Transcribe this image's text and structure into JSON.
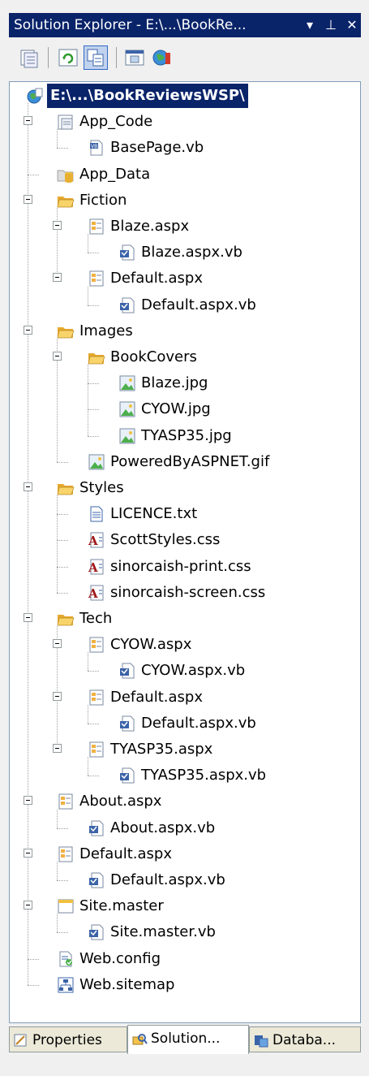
{
  "window": {
    "title": "Solution Explorer - E:\\...\\BookRe...",
    "buttons": [
      "▾",
      "⊥",
      "✕"
    ]
  },
  "toolbar": {
    "buttons": [
      "properties-icon",
      "refresh-icon",
      "nest-related-files-icon",
      "view-designer-icon",
      "copy-website-icon"
    ]
  },
  "tree": {
    "root": "E:\\...\\BookReviewsWSP\\",
    "nodes": [
      {
        "label": "App_Code",
        "icon": "special-folder-icon"
      },
      {
        "label": "BasePage.vb",
        "icon": "vb-file-icon"
      },
      {
        "label": "App_Data",
        "icon": "data-folder-icon"
      },
      {
        "label": "Fiction",
        "icon": "folder-open-icon"
      },
      {
        "label": "Blaze.aspx",
        "icon": "aspx-file-icon"
      },
      {
        "label": "Blaze.aspx.vb",
        "icon": "codebehind-icon"
      },
      {
        "label": "Default.aspx",
        "icon": "aspx-file-icon"
      },
      {
        "label": "Default.aspx.vb",
        "icon": "codebehind-icon"
      },
      {
        "label": "Images",
        "icon": "folder-open-icon"
      },
      {
        "label": "BookCovers",
        "icon": "folder-open-icon"
      },
      {
        "label": "Blaze.jpg",
        "icon": "image-file-icon"
      },
      {
        "label": "CYOW.jpg",
        "icon": "image-file-icon"
      },
      {
        "label": "TYASP35.jpg",
        "icon": "image-file-icon"
      },
      {
        "label": "PoweredByASPNET.gif",
        "icon": "image-file-icon"
      },
      {
        "label": "Styles",
        "icon": "folder-open-icon"
      },
      {
        "label": "LICENCE.txt",
        "icon": "text-file-icon"
      },
      {
        "label": "ScottStyles.css",
        "icon": "css-file-icon"
      },
      {
        "label": "sinorcaish-print.css",
        "icon": "css-file-icon"
      },
      {
        "label": "sinorcaish-screen.css",
        "icon": "css-file-icon"
      },
      {
        "label": "Tech",
        "icon": "folder-open-icon"
      },
      {
        "label": "CYOW.aspx",
        "icon": "aspx-file-icon"
      },
      {
        "label": "CYOW.aspx.vb",
        "icon": "codebehind-icon"
      },
      {
        "label": "Default.aspx",
        "icon": "aspx-file-icon"
      },
      {
        "label": "Default.aspx.vb",
        "icon": "codebehind-icon"
      },
      {
        "label": "TYASP35.aspx",
        "icon": "aspx-file-icon"
      },
      {
        "label": "TYASP35.aspx.vb",
        "icon": "codebehind-icon"
      },
      {
        "label": "About.aspx",
        "icon": "aspx-file-icon"
      },
      {
        "label": "About.aspx.vb",
        "icon": "codebehind-icon"
      },
      {
        "label": "Default.aspx",
        "icon": "aspx-file-icon"
      },
      {
        "label": "Default.aspx.vb",
        "icon": "codebehind-icon"
      },
      {
        "label": "Site.master",
        "icon": "master-file-icon"
      },
      {
        "label": "Site.master.vb",
        "icon": "codebehind-icon"
      },
      {
        "label": "Web.config",
        "icon": "config-file-icon"
      },
      {
        "label": "Web.sitemap",
        "icon": "sitemap-file-icon"
      }
    ]
  },
  "tabs": [
    {
      "label": "Properties",
      "icon": "properties-tab-icon",
      "active": false
    },
    {
      "label": "Solution...",
      "icon": "solution-explorer-tab-icon",
      "active": true
    },
    {
      "label": "Databa...",
      "icon": "database-explorer-tab-icon",
      "active": false
    }
  ],
  "colors": {
    "title_bar": "#0a246a",
    "selection": "#0a246a",
    "folder": "#f5c24b"
  }
}
